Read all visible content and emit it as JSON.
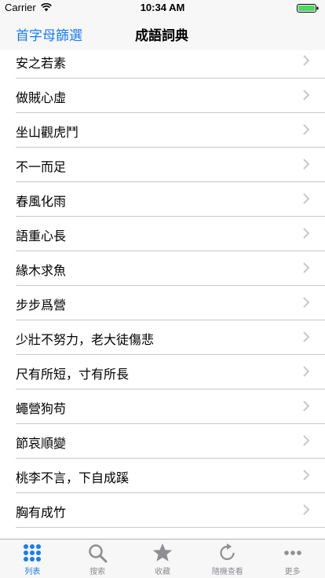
{
  "status_bar": {
    "carrier": "Carrier",
    "time": "10:34 AM"
  },
  "nav": {
    "left_button": "首字母篩選",
    "title": "成語詞典"
  },
  "list": {
    "items": [
      {
        "label": "安之若素"
      },
      {
        "label": "做賊心虛"
      },
      {
        "label": "坐山觀虎鬥"
      },
      {
        "label": "不一而足"
      },
      {
        "label": "春風化雨"
      },
      {
        "label": "語重心長"
      },
      {
        "label": "緣木求魚"
      },
      {
        "label": "步步爲營"
      },
      {
        "label": "少壯不努力，老大徒傷悲"
      },
      {
        "label": "尺有所短，寸有所長"
      },
      {
        "label": "蠅營狗苟"
      },
      {
        "label": "節哀順變"
      },
      {
        "label": "桃李不言，下自成蹊"
      },
      {
        "label": "胸有成竹"
      }
    ]
  },
  "tab_bar": {
    "tabs": [
      {
        "label": "列表",
        "icon": "grid-dots-icon"
      },
      {
        "label": "搜索",
        "icon": "search-icon"
      },
      {
        "label": "收藏",
        "icon": "star-icon"
      },
      {
        "label": "隨機查看",
        "icon": "refresh-icon"
      },
      {
        "label": "更多",
        "icon": "more-icon"
      }
    ],
    "active_tab": 0
  },
  "colors": {
    "accent": "#1a7cf5",
    "inactive": "#8e8e93",
    "separator": "#c8c7cc",
    "bar_background": "#f7f7f7"
  }
}
